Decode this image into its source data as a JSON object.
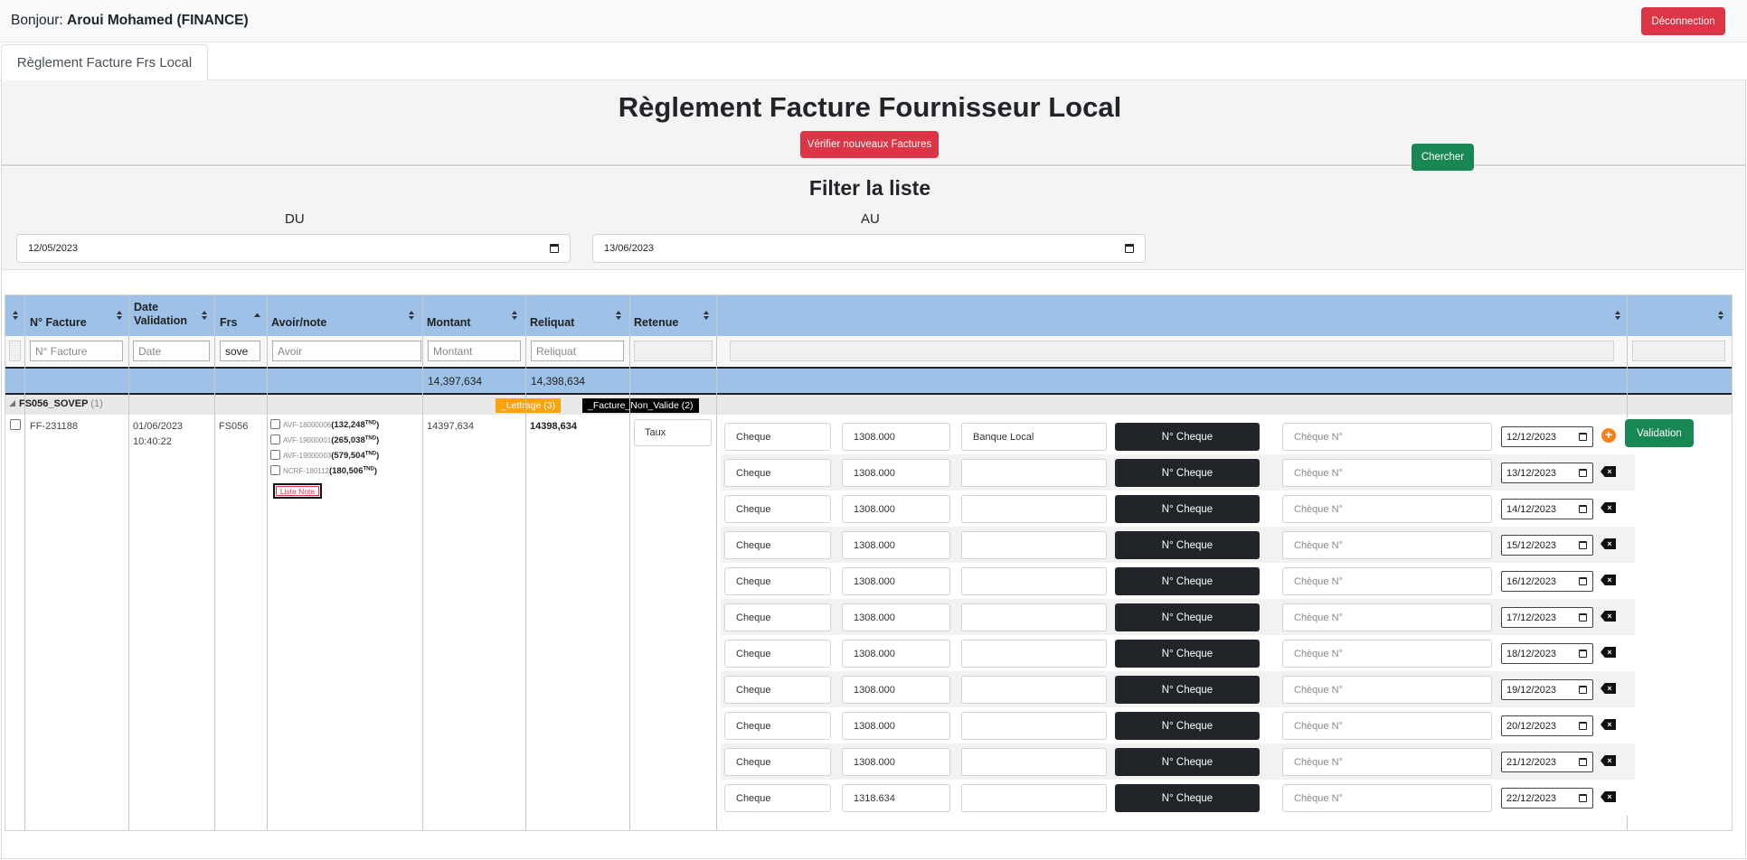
{
  "header": {
    "greeting_prefix": "Bonjour: ",
    "user": "Aroui Mohamed (FINANCE)",
    "logout_label": "Déconnection"
  },
  "tabs": [
    {
      "label": "Règlement Facture Frs Local"
    }
  ],
  "page": {
    "title": "Règlement Facture Fournisseur Local",
    "verify_label": "Vérifier nouveaux Factures"
  },
  "filter": {
    "title": "Filter la liste",
    "du_label": "DU",
    "au_label": "AU",
    "du_value": "12/05/2023",
    "au_value": "13/06/2023",
    "search_label": "Chercher"
  },
  "grid": {
    "columns": [
      "N° Facture",
      "Date Validation",
      "Frs",
      "Avoir/note",
      "Montant",
      "Reliquat",
      "Retenue"
    ],
    "filters": {
      "facture": "N° Facture",
      "date": "Date",
      "frs": "sove",
      "avoir": "Avoir",
      "montant": "Montant",
      "reliquat": "Reliquat"
    },
    "totals": {
      "montant": "14,397,634",
      "reliquat": "14,398,634"
    },
    "group": {
      "name": "FS056_SOVEP",
      "count": "(1)",
      "badge_lettrage": "_Lettrage (3)",
      "badge_non_valide": "_Facture_Non_Valide (2)"
    },
    "row": {
      "facture": "FF-231188",
      "date": "01/06/2023",
      "time": "10:40:22",
      "frs": "FS056",
      "montant": "14397,634",
      "reliquat": "14398,634",
      "retenue_placeholder": "Taux",
      "avoirs": [
        {
          "ref": "AVF-18000006",
          "amount": "(132,248",
          "unit": "TND",
          "close": ")"
        },
        {
          "ref": "AVF-19000001",
          "amount": "(265,038",
          "unit": "TND",
          "close": ")"
        },
        {
          "ref": "AVF-19000003",
          "amount": "(579,504",
          "unit": "TND",
          "close": ")"
        },
        {
          "ref": "NCRF-180112",
          "amount": "(180,506",
          "unit": "TND",
          "close": ")"
        }
      ],
      "liste_note_label": "Liste Note",
      "validation_label": "Validation"
    },
    "payments": [
      {
        "type": "Cheque",
        "amount": "1308.000",
        "bank": "Banque Local",
        "btn": "N° Cheque",
        "cheque_ph": "Chèque N°",
        "date": "12/12/2023",
        "action": "add"
      },
      {
        "type": "Cheque",
        "amount": "1308.000",
        "bank": "",
        "btn": "N° Cheque",
        "cheque_ph": "Chèque N°",
        "date": "13/12/2023",
        "action": "remove"
      },
      {
        "type": "Cheque",
        "amount": "1308.000",
        "bank": "",
        "btn": "N° Cheque",
        "cheque_ph": "Chèque N°",
        "date": "14/12/2023",
        "action": "remove"
      },
      {
        "type": "Cheque",
        "amount": "1308.000",
        "bank": "",
        "btn": "N° Cheque",
        "cheque_ph": "Chèque N°",
        "date": "15/12/2023",
        "action": "remove"
      },
      {
        "type": "Cheque",
        "amount": "1308.000",
        "bank": "",
        "btn": "N° Cheque",
        "cheque_ph": "Chèque N°",
        "date": "16/12/2023",
        "action": "remove"
      },
      {
        "type": "Cheque",
        "amount": "1308.000",
        "bank": "",
        "btn": "N° Cheque",
        "cheque_ph": "Chèque N°",
        "date": "17/12/2023",
        "action": "remove"
      },
      {
        "type": "Cheque",
        "amount": "1308.000",
        "bank": "",
        "btn": "N° Cheque",
        "cheque_ph": "Chèque N°",
        "date": "18/12/2023",
        "action": "remove"
      },
      {
        "type": "Cheque",
        "amount": "1308.000",
        "bank": "",
        "btn": "N° Cheque",
        "cheque_ph": "Chèque N°",
        "date": "19/12/2023",
        "action": "remove"
      },
      {
        "type": "Cheque",
        "amount": "1308.000",
        "bank": "",
        "btn": "N° Cheque",
        "cheque_ph": "Chèque N°",
        "date": "20/12/2023",
        "action": "remove"
      },
      {
        "type": "Cheque",
        "amount": "1308.000",
        "bank": "",
        "btn": "N° Cheque",
        "cheque_ph": "Chèque N°",
        "date": "21/12/2023",
        "action": "remove"
      },
      {
        "type": "Cheque",
        "amount": "1318.634",
        "bank": "",
        "btn": "N° Cheque",
        "cheque_ph": "Chèque N°",
        "date": "22/12/2023",
        "action": "remove"
      }
    ]
  },
  "colors": {
    "accent_danger": "#dc3545",
    "accent_success": "#198754",
    "grid_header": "#9ec1e8",
    "badge_orange": "#fca30e",
    "add_orange": "#fd7e14"
  }
}
